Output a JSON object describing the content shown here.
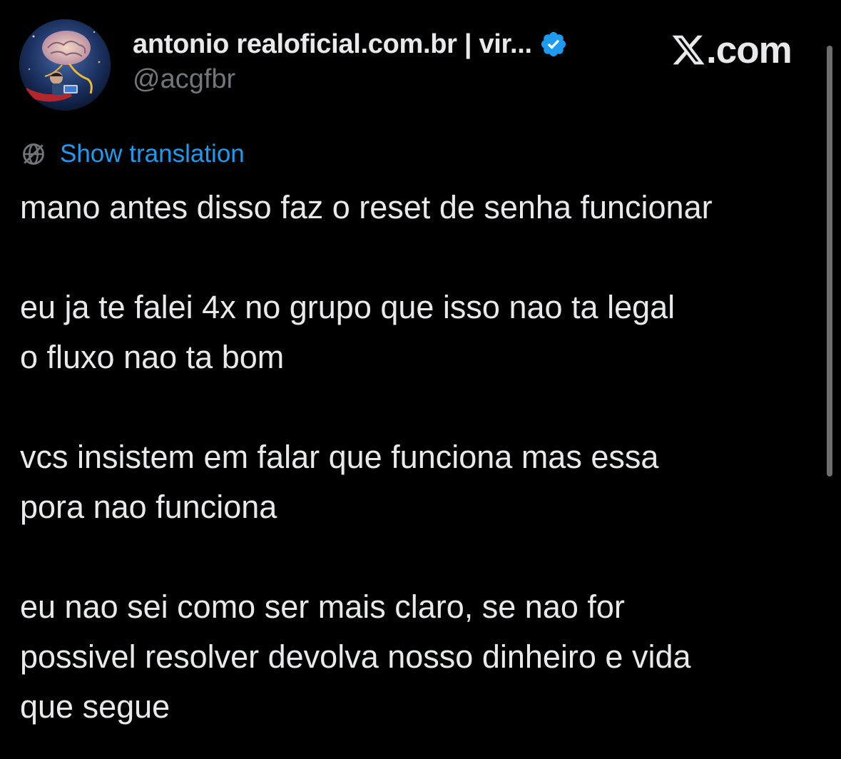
{
  "author": {
    "display_name": "antonio realoficial.com.br | vir...",
    "handle": "@acgfbr",
    "verified": true
  },
  "brand": {
    "site_text": ".com"
  },
  "translation": {
    "link_text": "Show translation"
  },
  "tweet": {
    "paragraphs": [
      [
        "mano antes disso faz o reset de senha funcionar"
      ],
      [
        "eu ja te falei 4x no grupo que isso nao ta legal",
        "o fluxo nao ta bom"
      ],
      [
        "vcs insistem em falar que funciona mas essa",
        "pora nao funciona"
      ],
      [
        "eu nao sei como ser mais claro, se nao for",
        "possivel resolver devolva nosso dinheiro e vida",
        "que segue"
      ]
    ]
  },
  "icons": {
    "verified": "verified-badge-icon",
    "x_logo": "x-logo-icon",
    "translate": "globe-icon"
  },
  "colors": {
    "background": "#000000",
    "text": "#e7e9ea",
    "muted": "#71767b",
    "link": "#1d9bf0",
    "verified_badge": "#1d9bf0"
  }
}
